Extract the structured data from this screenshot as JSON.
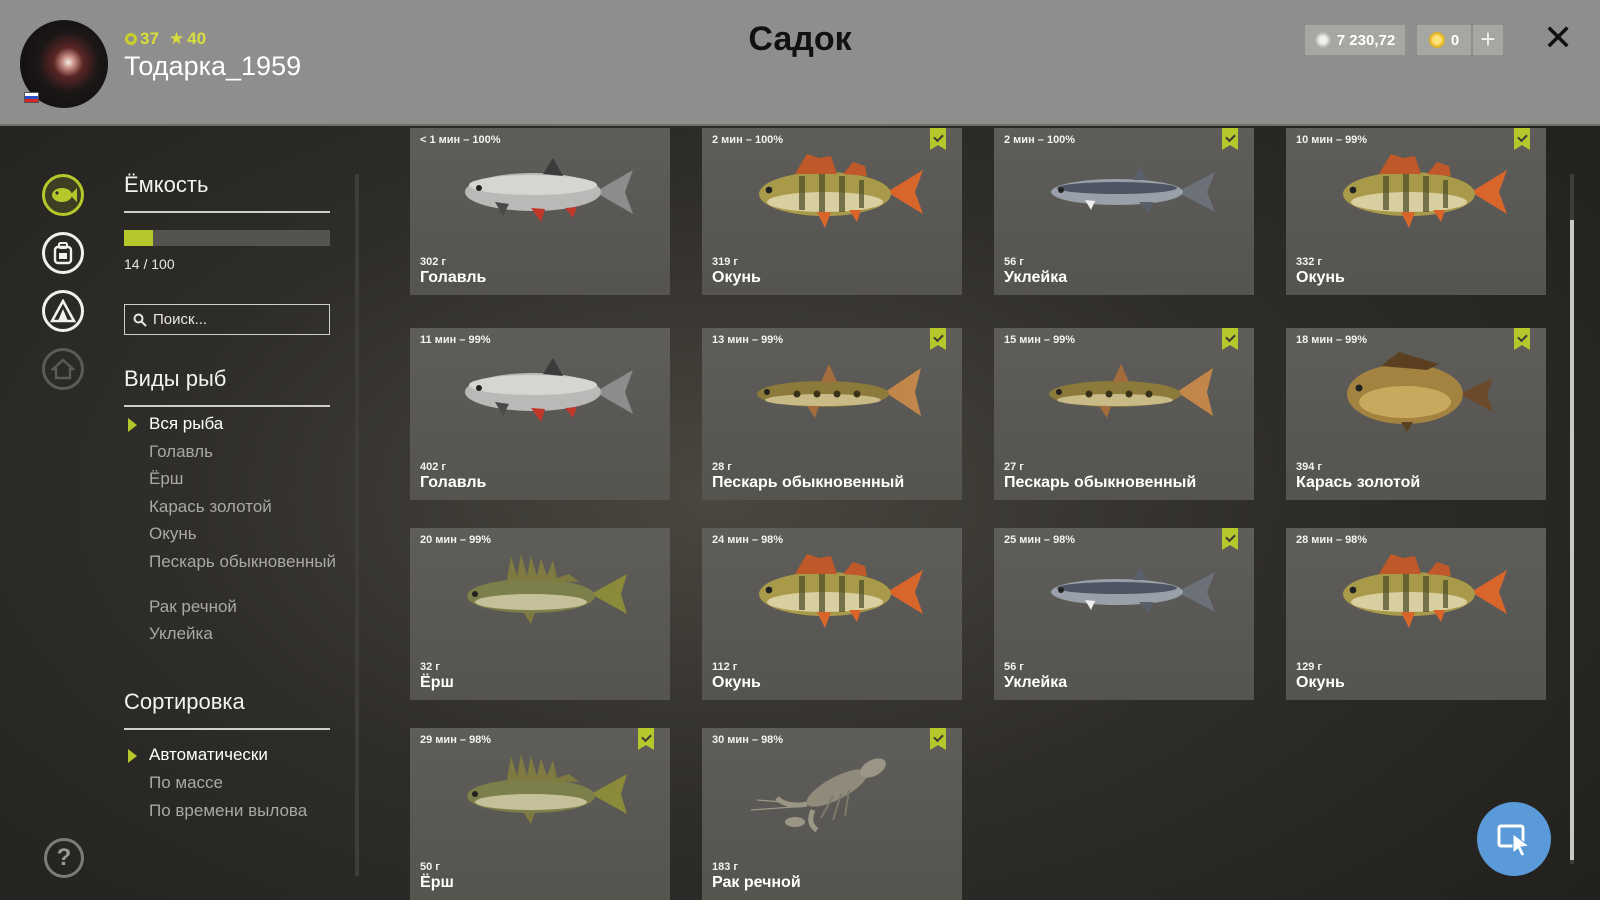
{
  "header": {
    "title": "Садок",
    "username": "Тодарка_1959",
    "level": "37",
    "stars": "40",
    "silver": "7 230,72",
    "gold": "0"
  },
  "panel": {
    "capacity_title": "Ёмкость",
    "capacity_text": "14 / 100",
    "capacity_fraction": 0.14,
    "search_placeholder": "Поиск...",
    "species_title": "Виды рыб",
    "species": [
      "Вся рыба",
      "Голавль",
      "Ёрш",
      "Карась золотой",
      "Окунь",
      "Пескарь обыкновенный",
      "Рак речной",
      "Уклейка"
    ],
    "species_selected": "Вся рыба",
    "sort_title": "Сортировка",
    "sort_options": [
      "Автоматически",
      "По массе",
      "По времени вылова"
    ],
    "sort_selected": "Автоматически"
  },
  "catches": [
    {
      "meta": "< 1 мин – 100%",
      "weight": "302 г",
      "name": "Голавль",
      "bookmark": false,
      "fish": "chub"
    },
    {
      "meta": "2 мин – 100%",
      "weight": "319 г",
      "name": "Окунь",
      "bookmark": true,
      "fish": "perch"
    },
    {
      "meta": "2 мин – 100%",
      "weight": "56 г",
      "name": "Уклейка",
      "bookmark": true,
      "fish": "bleak"
    },
    {
      "meta": "10 мин – 99%",
      "weight": "332 г",
      "name": "Окунь",
      "bookmark": true,
      "fish": "perch"
    },
    {
      "meta": "11 мин – 99%",
      "weight": "402 г",
      "name": "Голавль",
      "bookmark": false,
      "fish": "chub"
    },
    {
      "meta": "13 мин – 99%",
      "weight": "28 г",
      "name": "Пескарь обыкновенный",
      "bookmark": true,
      "fish": "gudgeon"
    },
    {
      "meta": "15 мин – 99%",
      "weight": "27 г",
      "name": "Пескарь обыкновенный",
      "bookmark": true,
      "fish": "gudgeon"
    },
    {
      "meta": "18 мин – 99%",
      "weight": "394 г",
      "name": "Карась золотой",
      "bookmark": true,
      "fish": "carp"
    },
    {
      "meta": "20 мин – 99%",
      "weight": "32 г",
      "name": "Ёрш",
      "bookmark": false,
      "fish": "ruffe"
    },
    {
      "meta": "24 мин – 98%",
      "weight": "112 г",
      "name": "Окунь",
      "bookmark": false,
      "fish": "perch"
    },
    {
      "meta": "25 мин – 98%",
      "weight": "56 г",
      "name": "Уклейка",
      "bookmark": true,
      "fish": "bleak"
    },
    {
      "meta": "28 мин – 98%",
      "weight": "129 г",
      "name": "Окунь",
      "bookmark": false,
      "fish": "perch"
    },
    {
      "meta": "29 мин – 98%",
      "weight": "50 г",
      "name": "Ёрш",
      "bookmark": true,
      "fish": "ruffe"
    },
    {
      "meta": "30 мин – 98%",
      "weight": "183 г",
      "name": "Рак речной",
      "bookmark": true,
      "fish": "crayfish"
    }
  ],
  "colors": {
    "accent": "#b6c72b",
    "header_bg": "#8e8e8c",
    "card_bg": "#5c5b58",
    "cursor_button": "#5a9ad8"
  },
  "icons": [
    "fish-icon",
    "backpack-icon",
    "tent-icon",
    "home-icon",
    "help-icon",
    "close-icon",
    "plus-icon",
    "cursor-icon"
  ]
}
